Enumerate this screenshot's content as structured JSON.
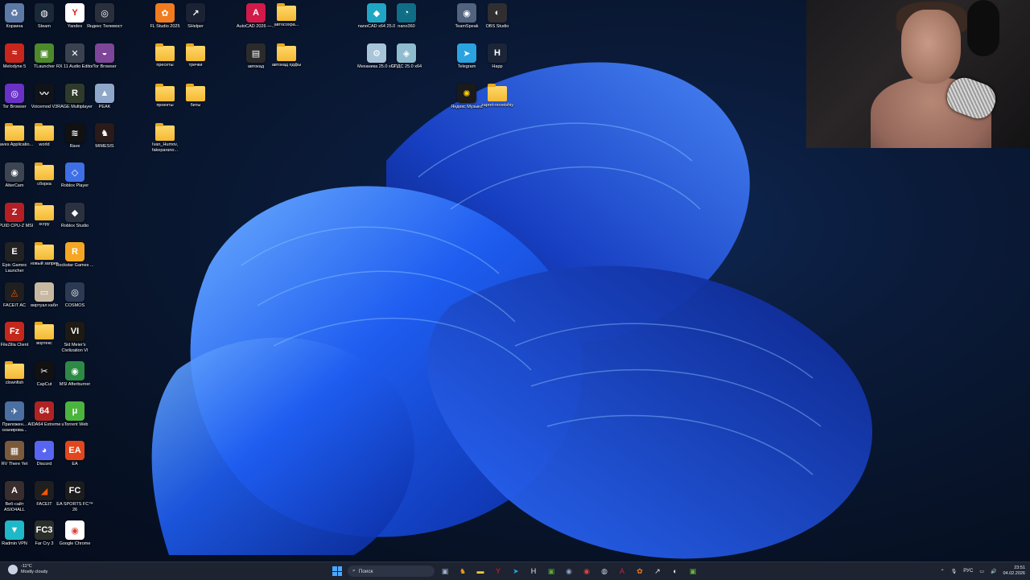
{
  "desktop": {
    "icons": [
      {
        "label": "Корзина",
        "kind": "app",
        "color": "#5d7aa6",
        "glyph": "♻"
      },
      {
        "label": "Steam",
        "kind": "app",
        "color": "#1b2838",
        "glyph": "◍"
      },
      {
        "label": "Yandex",
        "kind": "app",
        "color": "#ffffff",
        "glyph": "Y",
        "fg": "#e02020"
      },
      {
        "label": "Яндекс Телемост",
        "kind": "app",
        "color": "#2a2f3c",
        "glyph": "◎"
      },
      {
        "label": "FL Studio 2025",
        "kind": "app",
        "color": "#f07c1f",
        "glyph": "✿"
      },
      {
        "label": "SHelper",
        "kind": "app",
        "color": "#1a2233",
        "glyph": "↗"
      },
      {
        "label": "AutoCAD 2026 —...",
        "kind": "app",
        "color": "#d11a48",
        "glyph": "A"
      },
      {
        "label": "автосохра...",
        "kind": "folder"
      },
      {
        "label": "nanoCAD x64 25.0",
        "kind": "app",
        "color": "#1fa6c4",
        "glyph": "◆"
      },
      {
        "label": "nano360",
        "kind": "app",
        "color": "#0f6d86",
        "glyph": "◔"
      },
      {
        "label": "TeamSpeak",
        "kind": "app",
        "color": "#51637f",
        "glyph": "◉"
      },
      {
        "label": "OBS Studio",
        "kind": "app",
        "color": "#302e31",
        "glyph": "◐"
      },
      {
        "label": "Melodyne 5",
        "kind": "app",
        "color": "#c8261c",
        "glyph": "≈"
      },
      {
        "label": "TLauncher",
        "kind": "app",
        "color": "#4d8a2b",
        "glyph": "▣"
      },
      {
        "label": "RX 11 Audio Editor",
        "kind": "app",
        "color": "#3a4250",
        "glyph": "✕"
      },
      {
        "label": "Tor Browser",
        "kind": "app",
        "color": "#7d4698",
        "glyph": "◒"
      },
      {
        "label": "пресеты",
        "kind": "folder"
      },
      {
        "label": "тречки",
        "kind": "folder"
      },
      {
        "label": "автокад",
        "kind": "app",
        "color": "#2b2b2b",
        "glyph": "▤"
      },
      {
        "label": "автокад пдфы",
        "kind": "folder"
      },
      {
        "label": "Механика 25.0 x64",
        "kind": "app",
        "color": "#a8c4d8",
        "glyph": "⚙"
      },
      {
        "label": "СПДС 25.0 x64",
        "kind": "app",
        "color": "#8fbccf",
        "glyph": "◈"
      },
      {
        "label": "Telegram",
        "kind": "app",
        "color": "#2aa3e0",
        "glyph": "➤"
      },
      {
        "label": "Happ",
        "kind": "app",
        "color": "#1c2538",
        "glyph": "H"
      },
      {
        "label": "Tor Browser",
        "kind": "app",
        "color": "#6a31c8",
        "glyph": "◎"
      },
      {
        "label": "Voicemod V3",
        "kind": "app",
        "color": "#101418",
        "glyph": "〰"
      },
      {
        "label": "RAGE Multiplayer",
        "kind": "app",
        "color": "#2f3a2a",
        "glyph": "R"
      },
      {
        "label": "PEAK",
        "kind": "app",
        "color": "#8fa7c9",
        "glyph": "▲"
      },
      {
        "label": "проекты",
        "kind": "folder"
      },
      {
        "label": "биты",
        "kind": "folder"
      },
      {
        "label": "Яндекс Музыка",
        "kind": "app",
        "color": "#1a1a1a",
        "glyph": "✺",
        "fg": "#ffcc00"
      },
      {
        "label": "zapret-noveishiy",
        "kind": "folder"
      },
      {
        "label": "Waves Applicatio...",
        "kind": "folder"
      },
      {
        "label": "world",
        "kind": "folder"
      },
      {
        "label": "Rave",
        "kind": "app",
        "color": "#111111",
        "glyph": "≋"
      },
      {
        "label": "MIMESIS",
        "kind": "app",
        "color": "#2a1a1a",
        "glyph": "♞"
      },
      {
        "label": "Ivan_Humov, fakeparano...",
        "kind": "folder"
      },
      {
        "label": "AlterCam",
        "kind": "app",
        "color": "#3d4552",
        "glyph": "◉"
      },
      {
        "label": "сборка",
        "kind": "folder"
      },
      {
        "label": "Roblox Player",
        "kind": "app",
        "color": "#3f6fe6",
        "glyph": "◇"
      },
      {
        "label": "CPUID CPU-Z MSI",
        "kind": "app",
        "color": "#b31f24",
        "glyph": "Z"
      },
      {
        "label": "scrpy",
        "kind": "folder"
      },
      {
        "label": "Roblox Studio",
        "kind": "app",
        "color": "#2c3140",
        "glyph": "◆"
      },
      {
        "label": "Epic Games Launcher",
        "kind": "app",
        "color": "#222222",
        "glyph": "E"
      },
      {
        "label": "новый запрет",
        "kind": "folder"
      },
      {
        "label": "Rockstar Games ...",
        "kind": "app",
        "color": "#f5a623",
        "glyph": "R"
      },
      {
        "label": "FACEIT AC",
        "kind": "app",
        "color": "#1f1f1f",
        "glyph": "◬",
        "fg": "#ff5500"
      },
      {
        "label": "виртуал кабл",
        "kind": "app",
        "color": "#c7b9a1",
        "glyph": "▭"
      },
      {
        "label": "COSMOS",
        "kind": "app",
        "color": "#2b3a52",
        "glyph": "◎"
      },
      {
        "label": "FileZilla Client",
        "kind": "app",
        "color": "#c4281c",
        "glyph": "Fz"
      },
      {
        "label": "вортекс",
        "kind": "folder"
      },
      {
        "label": "Sid Meier's Civilization VI",
        "kind": "app",
        "color": "#1d1a14",
        "glyph": "VI"
      },
      {
        "label": "clownfish",
        "kind": "folder"
      },
      {
        "label": "CapCut",
        "kind": "app",
        "color": "#111111",
        "glyph": "✂"
      },
      {
        "label": "MSI Afterburner",
        "kind": "app",
        "color": "#2d8a45",
        "glyph": "◉"
      },
      {
        "label": "Приложен... сканирова...",
        "kind": "app",
        "color": "#4a6fa0",
        "glyph": "✈"
      },
      {
        "label": "AIDA64 Extreme",
        "kind": "app",
        "color": "#b02323",
        "glyph": "64"
      },
      {
        "label": "uTorrent Web",
        "kind": "app",
        "color": "#4bb43d",
        "glyph": "μ"
      },
      {
        "label": "RV There Yet",
        "kind": "app",
        "color": "#7a5a3a",
        "glyph": "▦"
      },
      {
        "label": "Discord",
        "kind": "app",
        "color": "#5865f2",
        "glyph": "◕"
      },
      {
        "label": "EA",
        "kind": "app",
        "color": "#e2461d",
        "glyph": "EA"
      },
      {
        "label": "Веб-сайт ASIO4ALL",
        "kind": "app",
        "color": "#3a2d2d",
        "glyph": "A"
      },
      {
        "label": "FACEIT",
        "kind": "app",
        "color": "#1f1f1f",
        "glyph": "◢",
        "fg": "#ff5500"
      },
      {
        "label": "EA SPORTS FC™ 26",
        "kind": "app",
        "color": "#1c1c1c",
        "glyph": "FC"
      },
      {
        "label": "Radmin VPN",
        "kind": "app",
        "color": "#1fb8c8",
        "glyph": "▼"
      },
      {
        "label": "Far Cry 3",
        "kind": "app",
        "color": "#2a2f2a",
        "glyph": "FC3"
      },
      {
        "label": "Google Chrome",
        "kind": "app",
        "color": "#ffffff",
        "glyph": "◉",
        "fg": "#dd4437"
      }
    ]
  },
  "taskbar": {
    "weather": {
      "temp": "-11°C",
      "desc": "Mostly cloudy"
    },
    "search_placeholder": "Поиск",
    "pinned": [
      {
        "name": "task-view-icon",
        "glyph": "▣",
        "color": "#9fb0c8"
      },
      {
        "name": "mimesis-icon",
        "glyph": "♞",
        "color": "#f0a020"
      },
      {
        "name": "file-explorer-icon",
        "glyph": "▬",
        "color": "#ffc83d"
      },
      {
        "name": "yandex-icon",
        "glyph": "Y",
        "color": "#e02020"
      },
      {
        "name": "telegram-icon",
        "glyph": "➤",
        "color": "#2aa3e0"
      },
      {
        "name": "happ-icon",
        "glyph": "H",
        "color": "#e6e9ef"
      },
      {
        "name": "minecraft-icon",
        "glyph": "▣",
        "color": "#5aa83a"
      },
      {
        "name": "teamspeak-icon",
        "glyph": "◉",
        "color": "#8aa0c0"
      },
      {
        "name": "chrome-icon",
        "glyph": "◉",
        "color": "#dd4437"
      },
      {
        "name": "steam-icon",
        "glyph": "◍",
        "color": "#c7d5e0"
      },
      {
        "name": "autocad-icon",
        "glyph": "A",
        "color": "#d11a48"
      },
      {
        "name": "fl-studio-icon",
        "glyph": "✿",
        "color": "#f07c1f"
      },
      {
        "name": "shelper-icon",
        "glyph": "↗",
        "color": "#e6e9ef"
      },
      {
        "name": "obs-icon",
        "glyph": "◐",
        "color": "#e6e9ef"
      },
      {
        "name": "tlauncher-icon",
        "glyph": "▣",
        "color": "#6bb33c"
      }
    ],
    "tray": {
      "lang": "РУС",
      "time": "23:51",
      "date": "04.02.2026"
    }
  }
}
